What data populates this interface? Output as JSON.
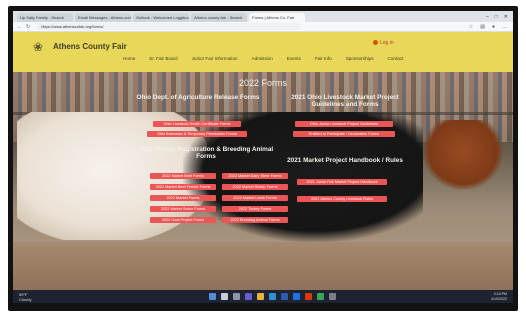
{
  "browser": {
    "tabs": [
      "Up Sally Family - Search",
      "Email Messages - Athens.com",
      "Outlook - Welcomed Loggibook",
      "Athens county fair - Search",
      "Forms | Athens Co. Fair"
    ],
    "active_tab": 4,
    "url": "https://www.athenscofair.org/forms/"
  },
  "site": {
    "title": "Athens County Fair",
    "login": "Log in",
    "nav": [
      "Home",
      "Sr. Fair Board",
      "Junior Fair Information",
      "Admission",
      "Events",
      "Fair Info",
      "Sponsorships",
      "Contact"
    ]
  },
  "page": {
    "title": "2022 Forms",
    "sections": [
      {
        "heading": "Ohio Dept. of Agriculture Release Forms",
        "items": [
          "Ohio Livestock Health Certificate Forms",
          "Ohio Extension & Temporary Permission Forms"
        ]
      },
      {
        "heading": "2021 Ohio Livestock Market Project Guidelines and Forms",
        "items": [
          "Ohio Junior Livestock Project Guidelines",
          "Entitled to Participate / Declaration Forms"
        ]
      },
      {
        "heading": "2022 Market Registration & Breeding Animal Forms",
        "items": [
          "2022 Market Beef Forms",
          "2022 Market Beef Feeder Forms",
          "2022 Market Forms",
          "2022 Market Swine Forms",
          "2022 Goat Project Forms",
          "2022 Market Dairy Steer Forms",
          "2022 Market Sheep Forms",
          "2022 Market Lamb Forms",
          "2022 Turkey Forms",
          "2022 Breeding Animal Forms"
        ]
      },
      {
        "heading": "2021 Market Project Handbook / Rules",
        "items": [
          "2021 Junior Fair Market Project Handbook",
          "2021 Athens County Livestock Rules"
        ]
      }
    ]
  },
  "taskbar": {
    "weather_temp": "59°F",
    "weather_desc": "Cloudy",
    "time": "3:18 PM",
    "date": "4/19/2022"
  },
  "colors": {
    "header": "#e9d75a",
    "button": "#ec5555",
    "taskbar": "#1f2230"
  }
}
